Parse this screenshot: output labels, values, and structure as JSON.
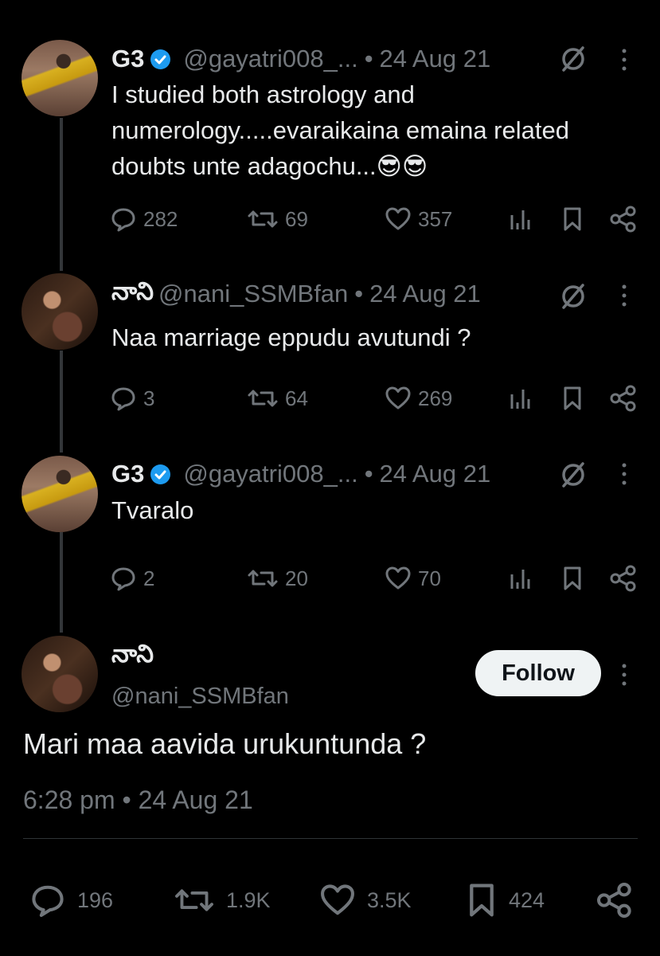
{
  "tweets": [
    {
      "name": "G3",
      "verified": true,
      "handle": "@gayatri008_...",
      "separator": "•",
      "date": "24 Aug 21",
      "text_lines": [
        "I studied both astrology and",
        "numerology.....evaraikaina emaina related",
        "doubts unte adagochu...😎😎"
      ],
      "replies": "282",
      "reposts": "69",
      "likes": "357"
    },
    {
      "name": "నాని",
      "verified": false,
      "handle": "@nani_SSMBfan",
      "separator": "•",
      "date": "24 Aug 21",
      "text_lines": [
        "Naa marriage eppudu avutundi ?"
      ],
      "replies": "3",
      "reposts": "64",
      "likes": "269"
    },
    {
      "name": "G3",
      "verified": true,
      "handle": "@gayatri008_...",
      "separator": "•",
      "date": "24 Aug 21",
      "text_lines": [
        "Tvaralo"
      ],
      "replies": "2",
      "reposts": "20",
      "likes": "70"
    }
  ],
  "main_tweet": {
    "name": "నాని",
    "handle": "@nani_SSMBfan",
    "follow_label": "Follow",
    "text": "Mari maa aavida urukuntunda ?",
    "timestamp": "6:28 pm • 24 Aug 21",
    "replies": "196",
    "reposts": "1.9K",
    "likes": "3.5K",
    "bookmarks": "424"
  },
  "colors": {
    "background": "#000000",
    "text": "#e7e9ea",
    "muted": "#71767b",
    "verified": "#1d9bf0",
    "follow_bg": "#eff3f4"
  },
  "icons": [
    "verified-badge-icon",
    "grok-icon",
    "more-icon",
    "reply-icon",
    "repost-icon",
    "like-icon",
    "views-icon",
    "bookmark-icon",
    "share-icon"
  ]
}
